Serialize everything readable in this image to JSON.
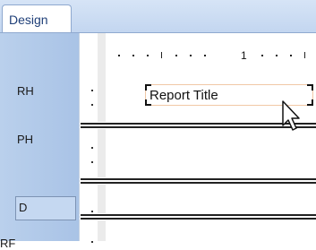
{
  "tab": {
    "label": "Design"
  },
  "ruler": {
    "marker": "1"
  },
  "bands": [
    {
      "label": "RH"
    },
    {
      "label": "PH"
    },
    {
      "label": "D"
    },
    {
      "label": "RF"
    }
  ],
  "report_title": {
    "text": "Report Title"
  }
}
